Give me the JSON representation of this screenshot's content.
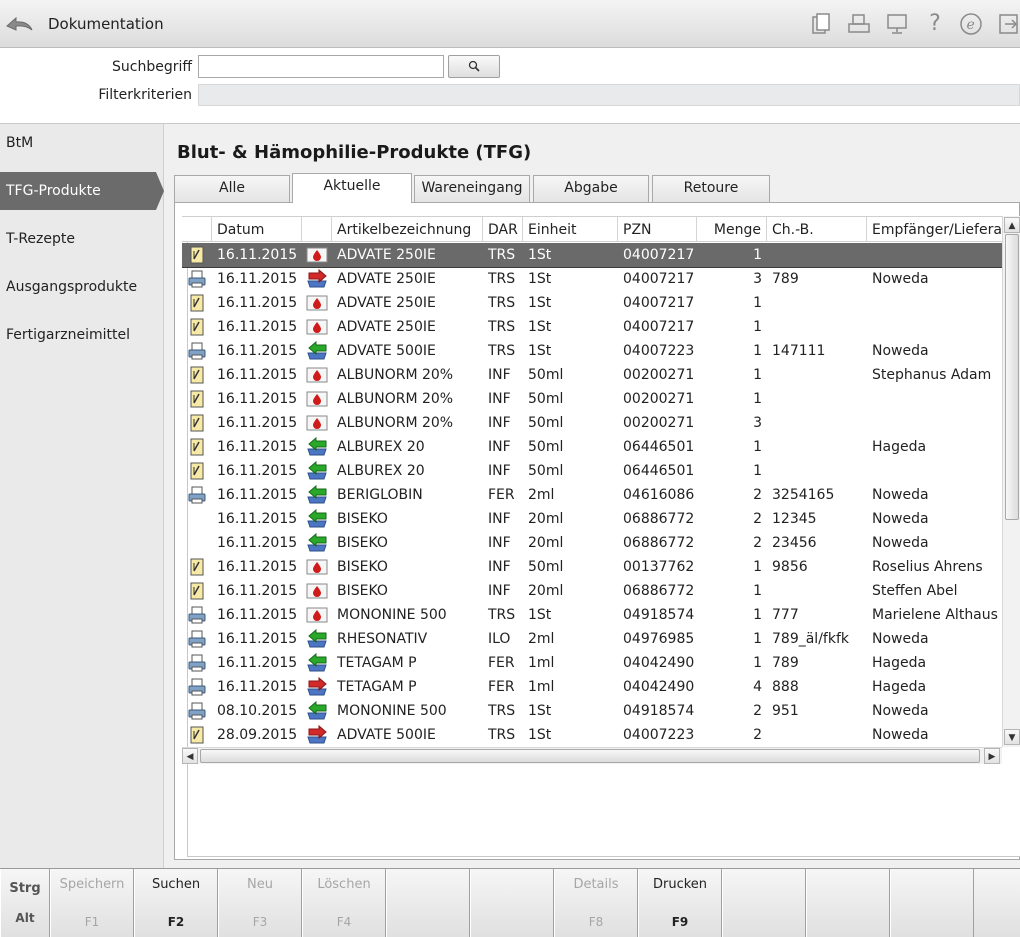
{
  "app": {
    "title": "Dokumentation"
  },
  "toolbar_icons": [
    "clipboard-icon",
    "printer-icon",
    "monitor-icon",
    "help-icon",
    "e-icon",
    "exit-icon"
  ],
  "search": {
    "label": "Suchbegriff",
    "value": "",
    "filter_label": "Filterkriterien",
    "filter_value": ""
  },
  "sidebar": {
    "items": [
      {
        "label": "BtM",
        "active": false
      },
      {
        "label": "TFG-Produkte",
        "active": true
      },
      {
        "label": "T-Rezepte",
        "active": false
      },
      {
        "label": "Ausgangsprodukte",
        "active": false
      },
      {
        "label": "Fertigarzneimittel",
        "active": false
      }
    ]
  },
  "main": {
    "title": "Blut- & Hämophilie-Produkte (TFG)",
    "tabs": [
      {
        "label": "Alle",
        "active": false
      },
      {
        "label": "Aktuelle",
        "active": true
      },
      {
        "label": "Wareneingang",
        "active": false
      },
      {
        "label": "Abgabe",
        "active": false
      },
      {
        "label": "Retoure",
        "active": false
      }
    ]
  },
  "table": {
    "headers": [
      "",
      "Datum",
      "",
      "Artikelbezeichnung",
      "DAR",
      "Einheit",
      "PZN",
      "Menge",
      "Ch.-B.",
      "Empfänger/Lieferant"
    ],
    "rows": [
      {
        "doc": "note-icon",
        "date": "16.11.2015",
        "type": "blood-icon",
        "name": "ADVATE 250IE",
        "dar": "TRS",
        "unit": "1St",
        "pzn": "04007217",
        "qty": "1",
        "batch": "",
        "party": "",
        "selected": true
      },
      {
        "doc": "printer-icon",
        "date": "16.11.2015",
        "type": "outgoing-icon",
        "name": "ADVATE 250IE",
        "dar": "TRS",
        "unit": "1St",
        "pzn": "04007217",
        "qty": "3",
        "batch": "789",
        "party": "Noweda"
      },
      {
        "doc": "note-icon",
        "date": "16.11.2015",
        "type": "blood-icon",
        "name": "ADVATE 250IE",
        "dar": "TRS",
        "unit": "1St",
        "pzn": "04007217",
        "qty": "1",
        "batch": "",
        "party": ""
      },
      {
        "doc": "note-icon",
        "date": "16.11.2015",
        "type": "blood-icon",
        "name": "ADVATE 250IE",
        "dar": "TRS",
        "unit": "1St",
        "pzn": "04007217",
        "qty": "1",
        "batch": "",
        "party": ""
      },
      {
        "doc": "printer-icon",
        "date": "16.11.2015",
        "type": "incoming-icon",
        "name": "ADVATE 500IE",
        "dar": "TRS",
        "unit": "1St",
        "pzn": "04007223",
        "qty": "1",
        "batch": "147111",
        "party": "Noweda"
      },
      {
        "doc": "note-icon",
        "date": "16.11.2015",
        "type": "blood-icon",
        "name": "ALBUNORM 20%",
        "dar": "INF",
        "unit": "50ml",
        "pzn": "00200271",
        "qty": "1",
        "batch": "",
        "party": "Stephanus Adam"
      },
      {
        "doc": "note-icon",
        "date": "16.11.2015",
        "type": "blood-icon",
        "name": "ALBUNORM 20%",
        "dar": "INF",
        "unit": "50ml",
        "pzn": "00200271",
        "qty": "1",
        "batch": "",
        "party": ""
      },
      {
        "doc": "note-icon",
        "date": "16.11.2015",
        "type": "blood-icon",
        "name": "ALBUNORM 20%",
        "dar": "INF",
        "unit": "50ml",
        "pzn": "00200271",
        "qty": "3",
        "batch": "",
        "party": ""
      },
      {
        "doc": "note-icon",
        "date": "16.11.2015",
        "type": "incoming-icon",
        "name": "ALBUREX 20",
        "dar": "INF",
        "unit": "50ml",
        "pzn": "06446501",
        "qty": "1",
        "batch": "",
        "party": "Hageda"
      },
      {
        "doc": "note-icon",
        "date": "16.11.2015",
        "type": "incoming-icon",
        "name": "ALBUREX 20",
        "dar": "INF",
        "unit": "50ml",
        "pzn": "06446501",
        "qty": "1",
        "batch": "",
        "party": ""
      },
      {
        "doc": "printer-icon",
        "date": "16.11.2015",
        "type": "incoming-icon",
        "name": "BERIGLOBIN",
        "dar": "FER",
        "unit": "2ml",
        "pzn": "04616086",
        "qty": "2",
        "batch": "3254165",
        "party": "Noweda"
      },
      {
        "doc": "",
        "date": "16.11.2015",
        "type": "incoming-icon",
        "name": "BISEKO",
        "dar": "INF",
        "unit": "20ml",
        "pzn": "06886772",
        "qty": "2",
        "batch": "12345",
        "party": "Noweda"
      },
      {
        "doc": "",
        "date": "16.11.2015",
        "type": "incoming-icon",
        "name": "BISEKO",
        "dar": "INF",
        "unit": "20ml",
        "pzn": "06886772",
        "qty": "2",
        "batch": "23456",
        "party": "Noweda"
      },
      {
        "doc": "note-icon",
        "date": "16.11.2015",
        "type": "blood-icon",
        "name": "BISEKO",
        "dar": "INF",
        "unit": "50ml",
        "pzn": "00137762",
        "qty": "1",
        "batch": "9856",
        "party": "Roselius Ahrens"
      },
      {
        "doc": "note-icon",
        "date": "16.11.2015",
        "type": "blood-icon",
        "name": "BISEKO",
        "dar": "INF",
        "unit": "20ml",
        "pzn": "06886772",
        "qty": "1",
        "batch": "",
        "party": "Steffen Abel"
      },
      {
        "doc": "printer-icon",
        "date": "16.11.2015",
        "type": "blood-icon",
        "name": "MONONINE 500",
        "dar": "TRS",
        "unit": "1St",
        "pzn": "04918574",
        "qty": "1",
        "batch": "777",
        "party": "Marielene Althaus"
      },
      {
        "doc": "printer-icon",
        "date": "16.11.2015",
        "type": "incoming-icon",
        "name": "RHESONATIV",
        "dar": "ILO",
        "unit": "2ml",
        "pzn": "04976985",
        "qty": "1",
        "batch": "789_äl/fkfk",
        "party": "Noweda"
      },
      {
        "doc": "printer-icon",
        "date": "16.11.2015",
        "type": "incoming-icon",
        "name": "TETAGAM P",
        "dar": "FER",
        "unit": "1ml",
        "pzn": "04042490",
        "qty": "1",
        "batch": "789",
        "party": "Hageda"
      },
      {
        "doc": "printer-icon",
        "date": "16.11.2015",
        "type": "outgoing-icon",
        "name": "TETAGAM P",
        "dar": "FER",
        "unit": "1ml",
        "pzn": "04042490",
        "qty": "4",
        "batch": "888",
        "party": "Hageda"
      },
      {
        "doc": "printer-icon",
        "date": "08.10.2015",
        "type": "incoming-icon",
        "name": "MONONINE 500",
        "dar": "TRS",
        "unit": "1St",
        "pzn": "04918574",
        "qty": "2",
        "batch": "951",
        "party": "Noweda"
      },
      {
        "doc": "note-icon",
        "date": "28.09.2015",
        "type": "outgoing-icon",
        "name": "ADVATE 500IE",
        "dar": "TRS",
        "unit": "1St",
        "pzn": "04007223",
        "qty": "2",
        "batch": "",
        "party": "Noweda"
      }
    ]
  },
  "fkeys": [
    {
      "label": "Strg",
      "key": "Alt",
      "disabled": false,
      "modifier": true
    },
    {
      "label": "Speichern",
      "key": "F1",
      "disabled": true
    },
    {
      "label": "Suchen",
      "key": "F2",
      "disabled": false
    },
    {
      "label": "Neu",
      "key": "F3",
      "disabled": true
    },
    {
      "label": "Löschen",
      "key": "F4",
      "disabled": true
    },
    {
      "label": "",
      "key": "",
      "disabled": true
    },
    {
      "label": "",
      "key": "",
      "disabled": true
    },
    {
      "label": "Details",
      "key": "F8",
      "disabled": true
    },
    {
      "label": "Drucken",
      "key": "F9",
      "disabled": false
    },
    {
      "label": "",
      "key": "",
      "disabled": true
    },
    {
      "label": "",
      "key": "",
      "disabled": true
    },
    {
      "label": "",
      "key": "",
      "disabled": true
    }
  ],
  "colors": {
    "selected_row": "#6a6a6a",
    "sidebar_active": "#6b6b6b",
    "incoming_arrow": "#2aa82a",
    "outgoing_arrow": "#d22a2a",
    "blood_drop": "#d11a1a"
  }
}
